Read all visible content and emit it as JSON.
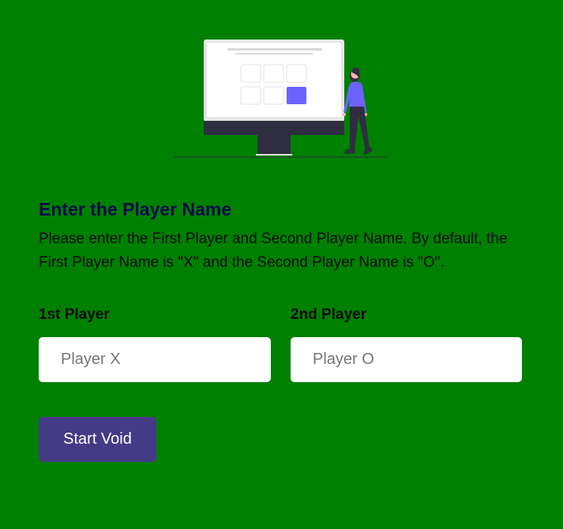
{
  "heading": "Enter the Player Name",
  "description": "Please enter the First Player and Second Player Name. By default, the First Player Name is \"X\" and the Second Player Name is \"O\".",
  "players": [
    {
      "label": "1st Player",
      "placeholder": "Player X",
      "value": ""
    },
    {
      "label": "2nd Player",
      "placeholder": "Player O",
      "value": ""
    }
  ],
  "start_button": {
    "label": "Start Void"
  },
  "illustration": {
    "icon": "person-with-monitor-tic-tac-toe-illustration",
    "accent_color": "#6c63ff",
    "dark_color": "#2f2e41"
  },
  "colors": {
    "background": "#008000",
    "heading": "#0b0b4a",
    "button": "#453a85"
  }
}
